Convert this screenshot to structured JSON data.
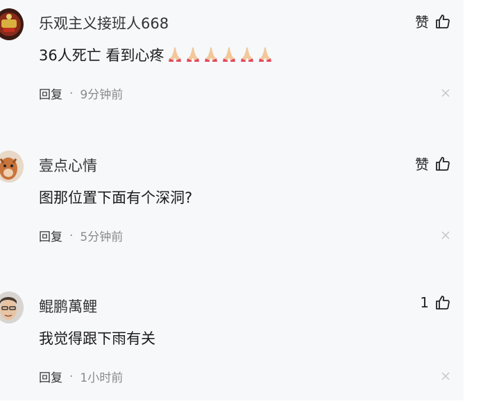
{
  "comments": [
    {
      "username": "乐观主义接班人668",
      "text": "36人死亡 看到心疼",
      "emoji": "pray-emoji",
      "emoji_count": 6,
      "like_label": "赞",
      "reply_label": "回复",
      "separator": "·",
      "time": "9分钟前"
    },
    {
      "username": "壹点心情",
      "text": "图那位置下面有个深洞?",
      "like_label": "赞",
      "reply_label": "回复",
      "separator": "·",
      "time": "5分钟前"
    },
    {
      "username": "鲲鹏萬鲤",
      "text": "我觉得跟下雨有关",
      "like_label": "1",
      "reply_label": "回复",
      "separator": "·",
      "time": "1小时前"
    }
  ],
  "icons": {
    "like": "thumbs-up-icon",
    "close": "close-icon"
  },
  "colors": {
    "panel_bg": "#f7f8fa",
    "text": "#1a1a1a",
    "meta": "#8a8a8a"
  }
}
